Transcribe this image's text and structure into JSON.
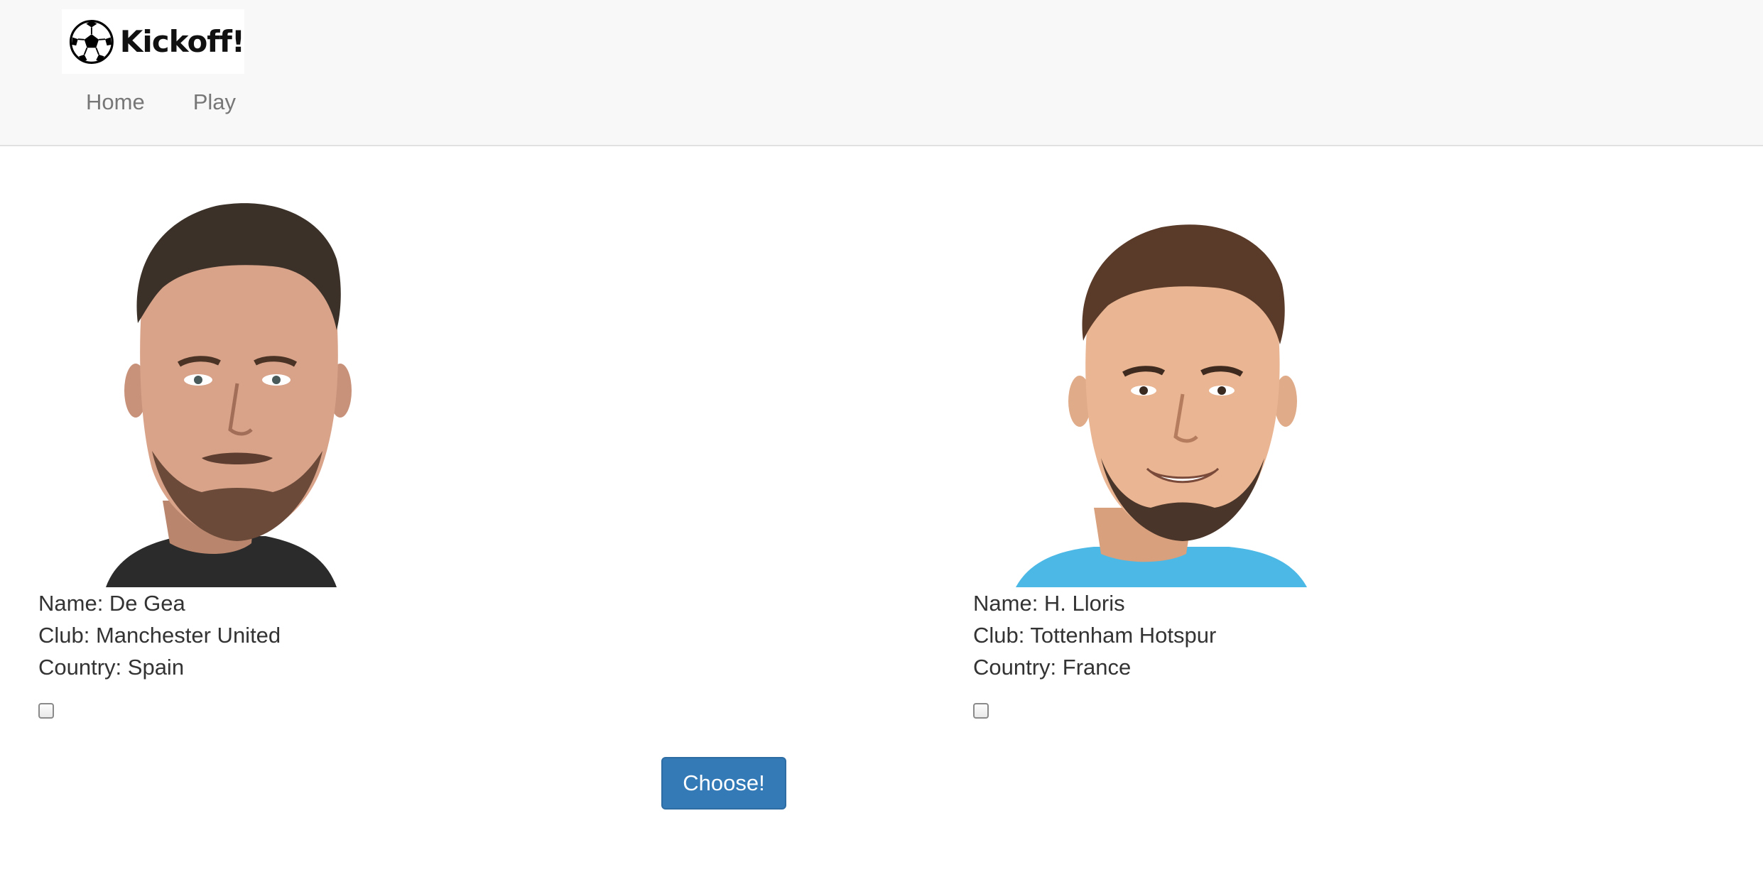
{
  "brand": {
    "name": "Kickoff!",
    "logo_icon": "soccer-ball-icon"
  },
  "nav": {
    "items": [
      {
        "label": "Home"
      },
      {
        "label": "Play"
      }
    ]
  },
  "players": [
    {
      "photo": "player-photo-de-gea",
      "shirt_color": "#2b2b2b",
      "name_line": "Name: De Gea",
      "club_line": "Club: Manchester United",
      "country_line": "Country: Spain",
      "checked": false
    },
    {
      "photo": "player-photo-h-lloris",
      "shirt_color": "#4cb8e6",
      "name_line": "Name: H. Lloris",
      "club_line": "Club: Tottenham Hotspur",
      "country_line": "Country: France",
      "checked": false
    }
  ],
  "choose_button": {
    "label": "Choose!",
    "color": "#337ab7"
  }
}
